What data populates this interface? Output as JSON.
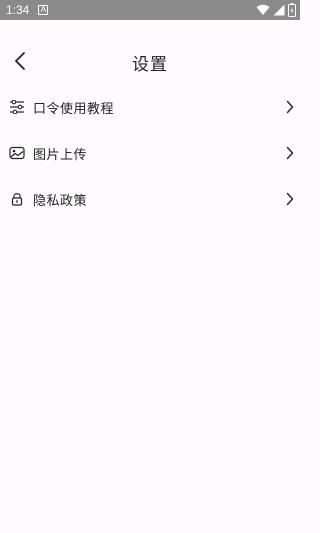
{
  "status_bar": {
    "time": "1:34",
    "notification_icon_letter": "A"
  },
  "header": {
    "title": "设置"
  },
  "menu": {
    "items": [
      {
        "label": "口令使用教程",
        "icon": "sliders-icon"
      },
      {
        "label": "图片上传",
        "icon": "image-icon"
      },
      {
        "label": "隐私政策",
        "icon": "lock-icon"
      }
    ]
  }
}
